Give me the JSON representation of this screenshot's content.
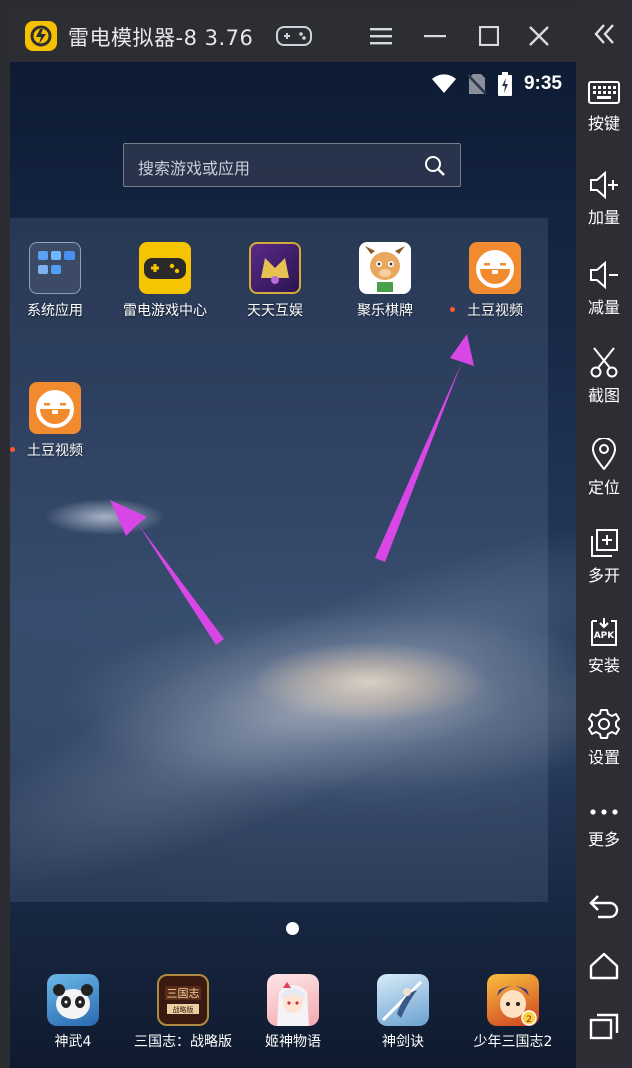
{
  "window": {
    "title": "雷电模拟器-8 3.76"
  },
  "status_bar": {
    "time": "9:35",
    "icons": [
      "wifi-icon",
      "no-sim-icon",
      "battery-charging-icon"
    ]
  },
  "search": {
    "placeholder": "搜索游戏或应用"
  },
  "home_apps": [
    {
      "label": "系统应用",
      "icon": "system-apps-folder-icon"
    },
    {
      "label": "雷电游戏中心",
      "icon": "leidian-game-center-icon"
    },
    {
      "label": "天天互娱",
      "icon": "tiantian-huyu-icon"
    },
    {
      "label": "聚乐棋牌",
      "icon": "jule-qipai-icon"
    },
    {
      "label": "土豆视频",
      "icon": "tudou-video-icon"
    },
    {
      "label": "土豆视频",
      "icon": "tudou-video-icon"
    }
  ],
  "dock_apps": [
    {
      "label": "神武4",
      "icon": "shenwu4-icon"
    },
    {
      "label": "三国志：战略版",
      "icon": "sanguozhi-icon"
    },
    {
      "label": "姬神物语",
      "icon": "jishen-wuyu-icon"
    },
    {
      "label": "神剑诀",
      "icon": "shenjianjue-icon"
    },
    {
      "label": "少年三国志2",
      "icon": "shaonian-sanguozhi2-icon"
    }
  ],
  "sidebar": {
    "items": [
      {
        "label": "按键",
        "icon": "keyboard-icon"
      },
      {
        "label": "加量",
        "icon": "volume-up-icon"
      },
      {
        "label": "减量",
        "icon": "volume-down-icon"
      },
      {
        "label": "截图",
        "icon": "scissors-icon"
      },
      {
        "label": "定位",
        "icon": "location-pin-icon"
      },
      {
        "label": "多开",
        "icon": "multi-instance-icon"
      },
      {
        "label": "安装",
        "icon": "apk-install-icon"
      },
      {
        "label": "设置",
        "icon": "gear-icon"
      },
      {
        "label": "更多",
        "icon": "more-dots-icon"
      }
    ]
  },
  "colors": {
    "chrome": "#2c2e33",
    "annotation_arrow": "#d946e6",
    "tudou_orange": "#f28a30",
    "notification_dot": "#ff5a2a"
  }
}
